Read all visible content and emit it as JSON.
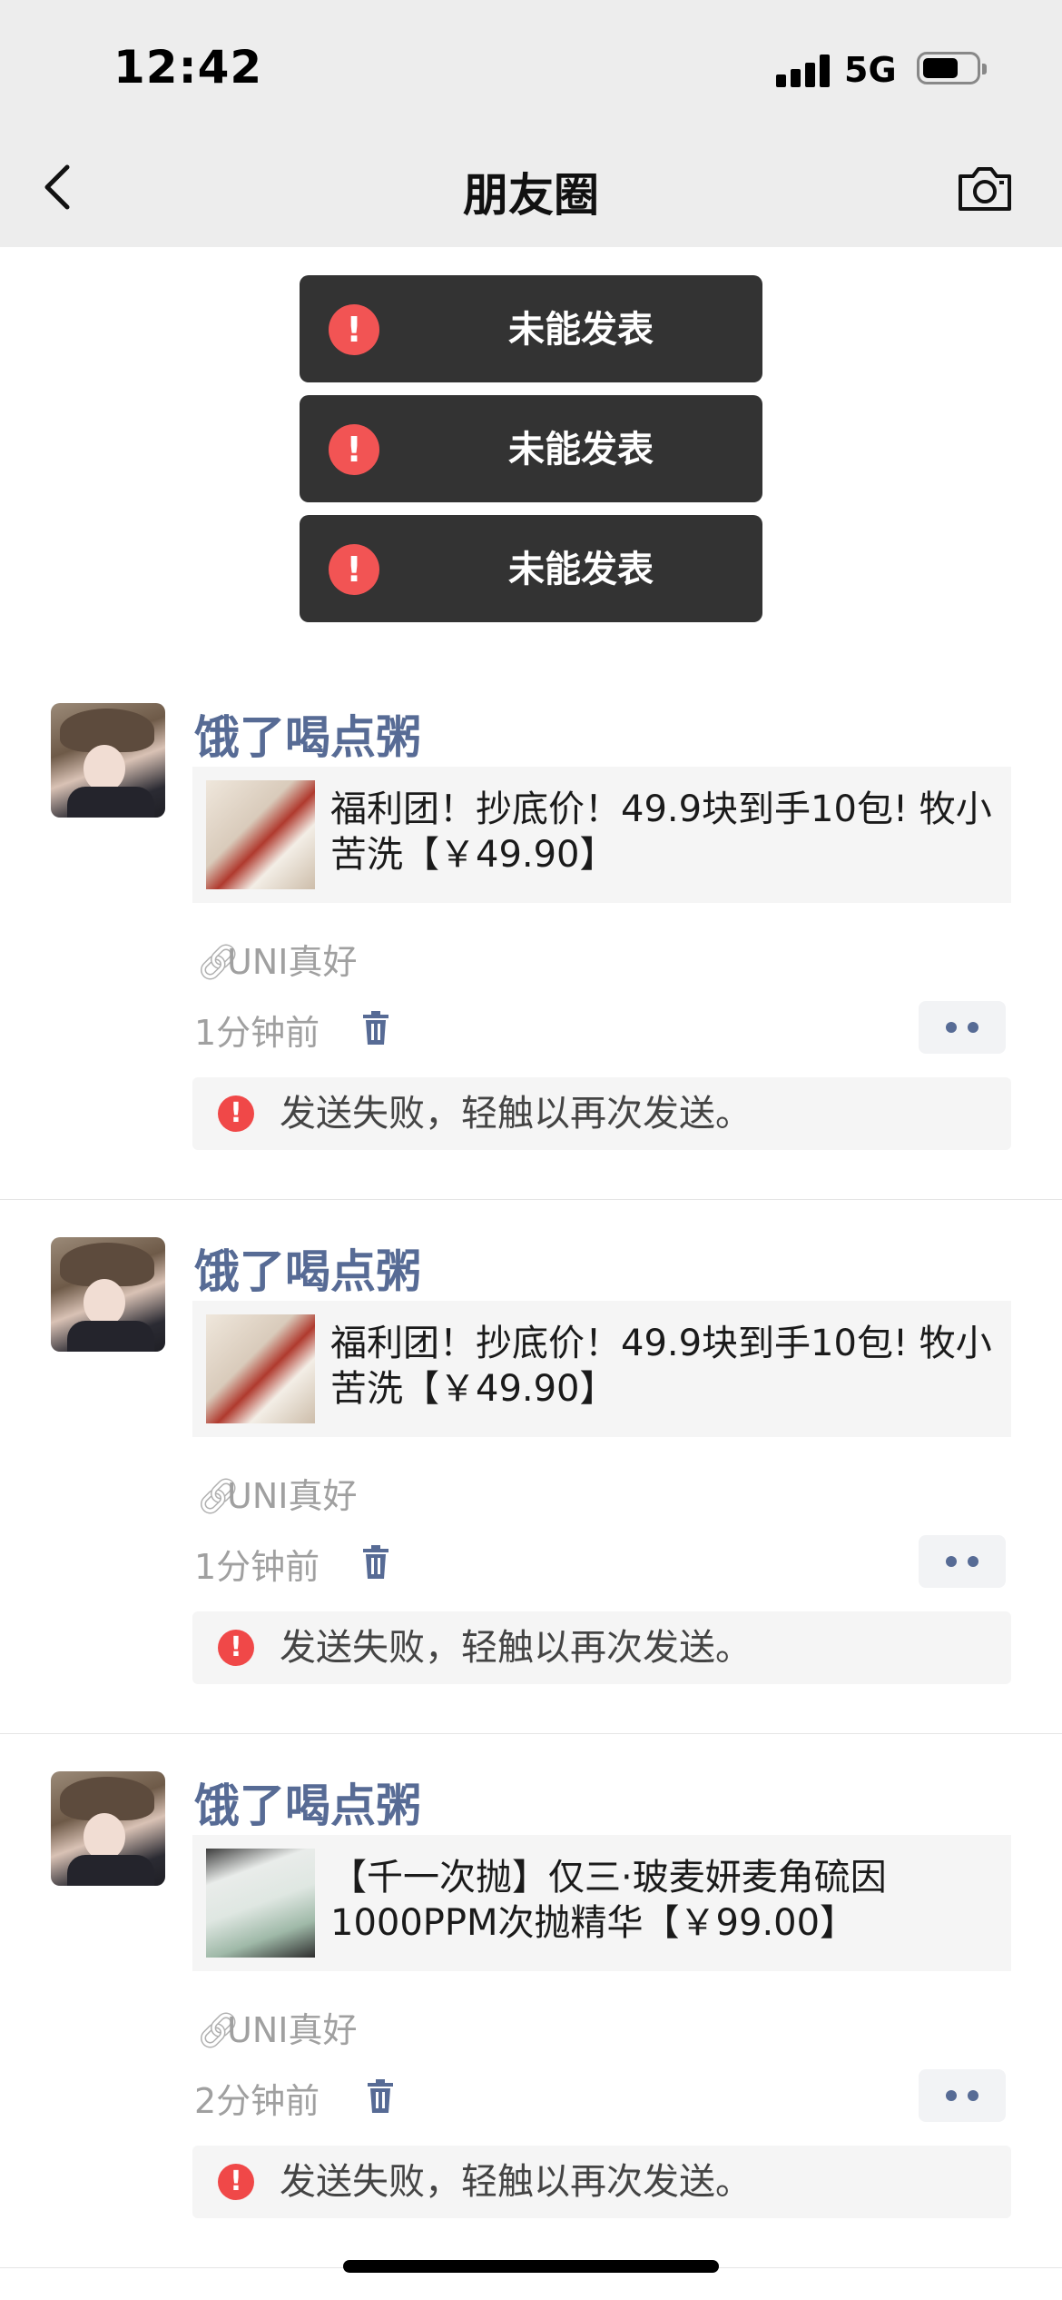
{
  "status_bar": {
    "time": "12:42",
    "network": "5G"
  },
  "nav": {
    "title": "朋友圈"
  },
  "toasts": [
    {
      "text": "未能发表"
    },
    {
      "text": "未能发表"
    },
    {
      "text": "未能发表"
    }
  ],
  "posts": [
    {
      "author": "饿了喝点粥",
      "card_title": "福利团！抄底价！49.9块到手10包! 牧小苦洗【￥49.90】",
      "source": "UNI真好",
      "time": "1分钟前",
      "error": "发送失败，轻触以再次发送。"
    },
    {
      "author": "饿了喝点粥",
      "card_title": "福利团！抄底价！49.9块到手10包! 牧小苦洗【￥49.90】",
      "source": "UNI真好",
      "time": "1分钟前",
      "error": "发送失败，轻触以再次发送。"
    },
    {
      "author": "饿了喝点粥",
      "card_title": "【千一次抛】仅三·玻麦妍麦角硫因1000PPM次抛精华【￥99.00】",
      "source": "UNI真好",
      "time": "2分钟前",
      "error": "发送失败，轻触以再次发送。"
    }
  ],
  "colors": {
    "link_blue": "#576b95",
    "error_red": "#f25454",
    "toast_bg": "#333333"
  },
  "icons": [
    "back-chevron-icon",
    "camera-icon",
    "alert-icon",
    "link-icon",
    "trash-icon",
    "more-dots-icon"
  ]
}
